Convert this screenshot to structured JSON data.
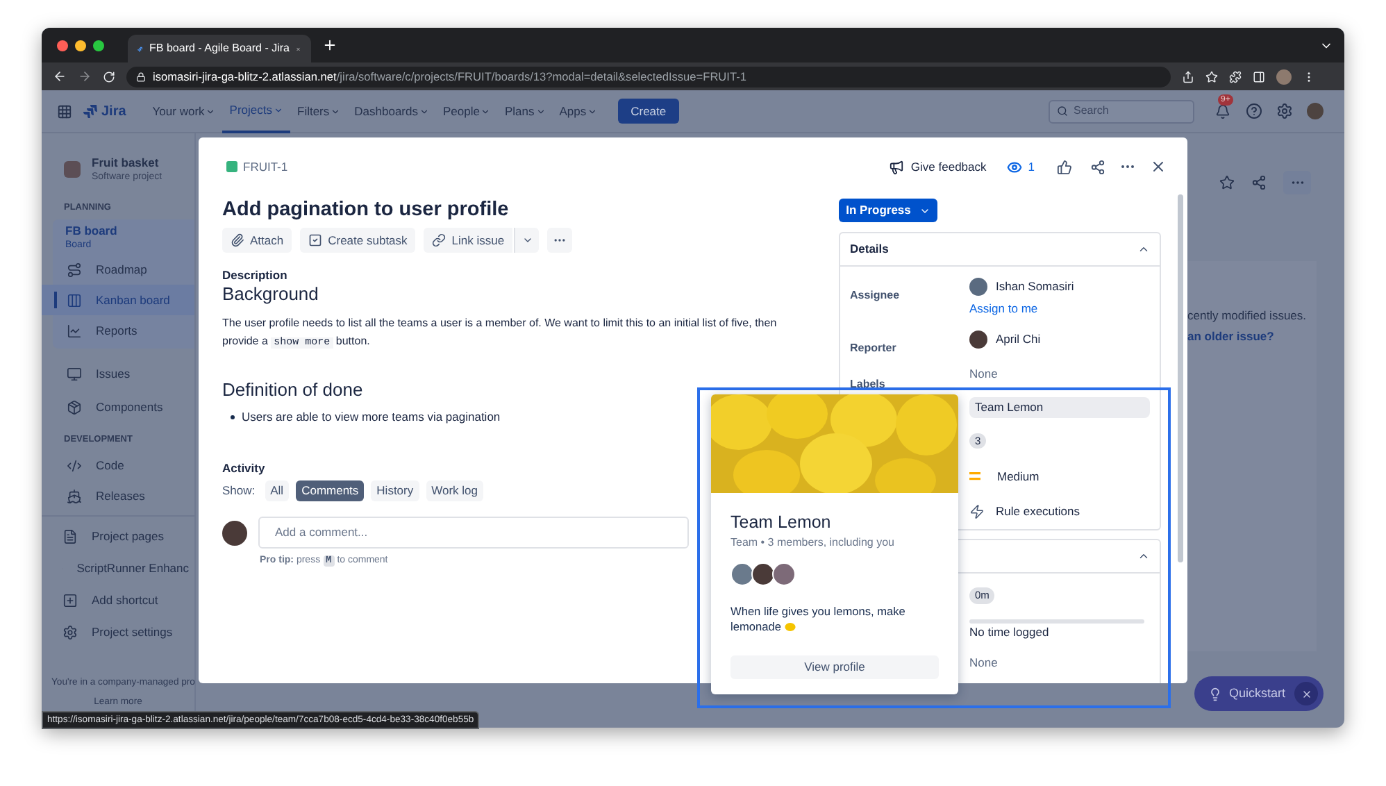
{
  "browser": {
    "tab_title": "FB board - Agile Board - Jira",
    "url_host": "isomasiri-jira-ga-blitz-2.atlassian.net",
    "url_path": "/jira/software/c/projects/FRUIT/boards/13?modal=detail&selectedIssue=FRUIT-1",
    "status_url": "https://isomasiri-jira-ga-blitz-2.atlassian.net/jira/people/team/7cca7b08-ecd5-4cd4-be33-38c40f0eb55b"
  },
  "nav": {
    "logo": "Jira",
    "items": [
      {
        "label": "Your work",
        "selected": false
      },
      {
        "label": "Projects",
        "selected": true
      },
      {
        "label": "Filters",
        "selected": false
      },
      {
        "label": "Dashboards",
        "selected": false
      },
      {
        "label": "People",
        "selected": false
      },
      {
        "label": "Plans",
        "selected": false
      },
      {
        "label": "Apps",
        "selected": false
      }
    ],
    "create": "Create",
    "search_placeholder": "Search",
    "notification_badge": "9+"
  },
  "sidebar": {
    "project": {
      "name": "Fruit basket",
      "type": "Software project"
    },
    "planning_heading": "PLANNING",
    "board": {
      "name": "FB board",
      "type": "Board",
      "items": [
        {
          "label": "Roadmap",
          "selected": false
        },
        {
          "label": "Kanban board",
          "selected": true
        },
        {
          "label": "Reports",
          "selected": false
        }
      ]
    },
    "items": [
      {
        "label": "Issues",
        "selected": false
      },
      {
        "label": "Components",
        "selected": false
      }
    ],
    "development_heading": "DEVELOPMENT",
    "dev_items": [
      {
        "label": "Code",
        "selected": false
      },
      {
        "label": "Releases",
        "selected": false
      }
    ],
    "extra_items": [
      {
        "label": "Project pages",
        "selected": false
      },
      {
        "label": "ScriptRunner Enhanc",
        "selected": false
      },
      {
        "label": "Add shortcut",
        "selected": false
      },
      {
        "label": "Project settings",
        "selected": false
      }
    ],
    "footer": "You're in a company-managed pro",
    "footer_link": "Learn more"
  },
  "board": {
    "message": "cently modified issues.",
    "link": "an older issue?"
  },
  "issue": {
    "key": "FRUIT-1",
    "feedback": "Give feedback",
    "watchers": "1",
    "title": "Add pagination to user profile",
    "actions": [
      "Attach",
      "Create subtask",
      "Link issue"
    ],
    "description_label": "Description",
    "background_heading": "Background",
    "paragraph": {
      "before": "The user profile needs to list all the teams a user is a member of. We want to limit this to an initial list of five, then provide a",
      "code": "show more",
      "after": "button."
    },
    "done_heading": "Definition of done",
    "bullets": [
      "Users are able to view more teams via pagination"
    ]
  },
  "activity": {
    "heading": "Activity",
    "show_label": "Show:",
    "filters": [
      {
        "label": "All",
        "selected": false
      },
      {
        "label": "Comments",
        "selected": true
      },
      {
        "label": "History",
        "selected": false
      },
      {
        "label": "Work log",
        "selected": false
      }
    ],
    "comment_placeholder": "Add a comment...",
    "pro_tip": {
      "label": "Pro tip:",
      "before": "press",
      "key": "M",
      "after": "to comment"
    }
  },
  "status": "In Progress",
  "details": {
    "title": "Details",
    "expanded": true,
    "rows": [
      {
        "kind": "user",
        "label": "Assignee",
        "value": "Ishan Somasiri",
        "link": "Assign to me"
      },
      {
        "kind": "user",
        "label": "Reporter",
        "value": "April Chi"
      },
      {
        "kind": "text",
        "label": "Labels",
        "value": "None"
      },
      {
        "kind": "field",
        "value": "Team Lemon"
      },
      {
        "kind": "badge",
        "value": "3"
      },
      {
        "kind": "priority",
        "value": "Medium"
      },
      {
        "kind": "automation",
        "value": "Rule executions"
      }
    ]
  },
  "time_panel": {
    "expanded": true,
    "rows": [
      {
        "kind": "badge",
        "value": "0m"
      },
      {
        "kind": "tracking",
        "level": 0,
        "value": "No time logged"
      },
      {
        "kind": "text",
        "value": "None"
      }
    ]
  },
  "team_card": {
    "name": "Team Lemon",
    "meta": "Team • 3 members, including you",
    "motto_lines": [
      "When life gives you lemons, make",
      "lemonade"
    ],
    "button": "View profile"
  },
  "quickstart": {
    "label": "Quickstart"
  }
}
